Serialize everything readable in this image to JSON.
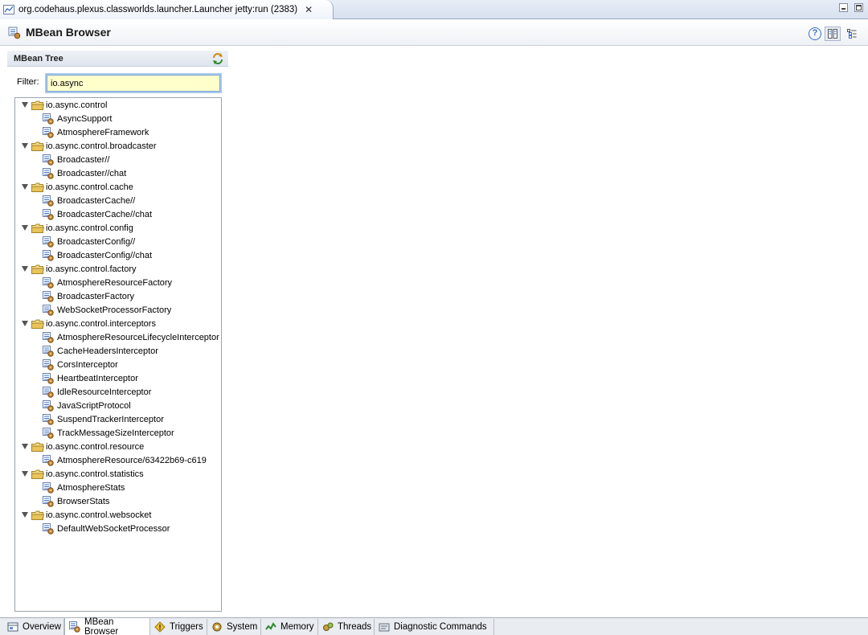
{
  "window": {
    "tab_title": "org.codehaus.plexus.classworlds.launcher.Launcher jetty:run (2383)",
    "close_glyph": "✕"
  },
  "header": {
    "title": "MBean Browser",
    "help_glyph": "?"
  },
  "tree_panel": {
    "title": "MBean Tree",
    "filter_label": "Filter:",
    "filter_value": "io.async"
  },
  "tree": [
    {
      "label": "io.async.control",
      "children": [
        "AsyncSupport",
        "AtmosphereFramework"
      ]
    },
    {
      "label": "io.async.control.broadcaster",
      "children": [
        "Broadcaster//",
        "Broadcaster//chat"
      ]
    },
    {
      "label": "io.async.control.cache",
      "children": [
        "BroadcasterCache//",
        "BroadcasterCache//chat"
      ]
    },
    {
      "label": "io.async.control.config",
      "children": [
        "BroadcasterConfig//",
        "BroadcasterConfig//chat"
      ]
    },
    {
      "label": "io.async.control.factory",
      "children": [
        "AtmosphereResourceFactory",
        "BroadcasterFactory",
        "WebSocketProcessorFactory"
      ]
    },
    {
      "label": "io.async.control.interceptors",
      "children": [
        "AtmosphereResourceLifecycleInterceptor",
        "CacheHeadersInterceptor",
        "CorsInterceptor",
        "HeartbeatInterceptor",
        "IdleResourceInterceptor",
        "JavaScriptProtocol",
        "SuspendTrackerInterceptor",
        "TrackMessageSizeInterceptor"
      ]
    },
    {
      "label": "io.async.control.resource",
      "children": [
        "AtmosphereResource/63422b69-c619"
      ]
    },
    {
      "label": "io.async.control.statistics",
      "children": [
        "AtmosphereStats",
        "BrowserStats"
      ]
    },
    {
      "label": "io.async.control.websocket",
      "children": [
        "DefaultWebSocketProcessor"
      ]
    }
  ],
  "bottom_tabs": [
    {
      "label": "Overview",
      "icon": "overview-icon"
    },
    {
      "label": "MBean Browser",
      "icon": "mbean-icon",
      "active": true
    },
    {
      "label": "Triggers",
      "icon": "trigger-icon"
    },
    {
      "label": "System",
      "icon": "system-icon"
    },
    {
      "label": "Memory",
      "icon": "memory-icon"
    },
    {
      "label": "Threads",
      "icon": "threads-icon"
    },
    {
      "label": "Diagnostic Commands",
      "icon": "diagnostic-icon"
    }
  ],
  "colors": {
    "filter_background": "#ffffcc",
    "folder": "#e8c45a",
    "accent": "#3a6fc4"
  }
}
